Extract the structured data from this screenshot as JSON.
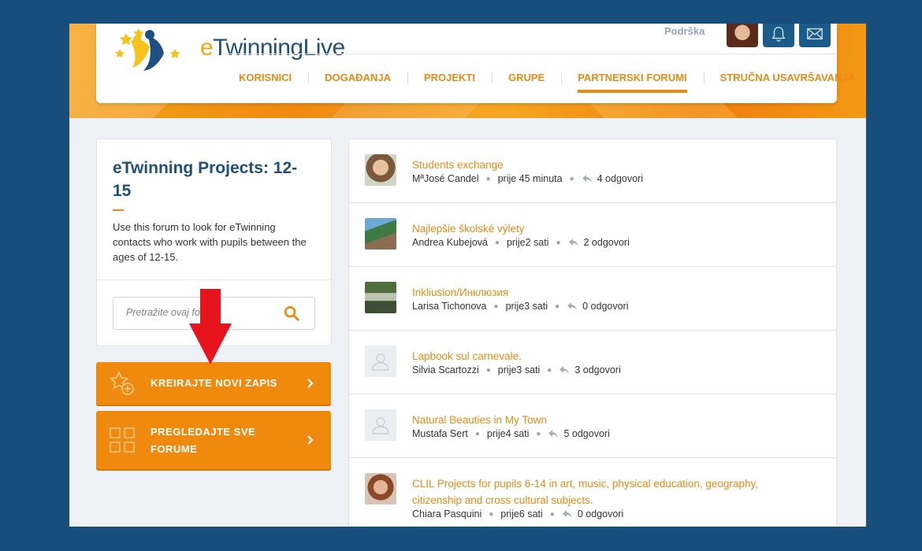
{
  "header": {
    "logo_text_e": "e",
    "logo_text_rest": "Twinning",
    "logo_text_live": "Live",
    "support_label": "Podrška",
    "nav": [
      {
        "label": "KORISNICI",
        "active": false
      },
      {
        "label": "DOGAĐANJA",
        "active": false
      },
      {
        "label": "PROJEKTI",
        "active": false
      },
      {
        "label": "GRUPE",
        "active": false
      },
      {
        "label": "PARTNERSKI FORUMI",
        "active": true
      },
      {
        "label": "STRUČNA USAVRŠAVANJA",
        "active": false
      }
    ]
  },
  "forum_info": {
    "title": "eTwinning Projects: 12-15",
    "description": "Use this forum to look for eTwinning contacts who work with pupils between the ages of 12-15.",
    "search_placeholder": "Pretražite ovaj forum"
  },
  "actions": {
    "create_label": "KREIRAJTE NOVI ZAPIS",
    "browse_label_line1": "PREGLEDAJTE SVE",
    "browse_label_line2": "FORUME"
  },
  "posts": [
    {
      "title": "Students exchange",
      "author": "MªJosé Candel",
      "time": "prije 45 minuta",
      "replies": "4 odgovori",
      "avatar": "photo-woman-smiling"
    },
    {
      "title": "Najlepšie školské výlety",
      "author": "Andrea Kubejová",
      "time": "prije2 sati",
      "replies": "2 odgovori",
      "avatar": "photo-outdoor"
    },
    {
      "title": "Inkliusion/Инклюзия",
      "author": "Larisa Tichonova",
      "time": "prije3 sati",
      "replies": "0 odgovori",
      "avatar": "photo-statue"
    },
    {
      "title": "Lapbook sul carnevale.",
      "author": "Silvia Scartozzi",
      "time": "prije3 sati",
      "replies": "3 odgovori",
      "avatar": "placeholder"
    },
    {
      "title": "Natural Beauties in My Town",
      "author": "Mustafa Sert",
      "time": "prije4 sati",
      "replies": "5 odgovori",
      "avatar": "placeholder"
    },
    {
      "title": "CLIL Projects for pupils 6-14 in art, music, physical education, geography, citizenship and cross cultural subjects.",
      "author": "Chiara Pasquini",
      "time": "prije6 sati",
      "replies": "0 odgovori",
      "avatar": "photo-woman-short-hair"
    }
  ],
  "colors": {
    "accent": "#e68a18",
    "navy": "#1f4f7a",
    "page_bg": "#174e7c",
    "button": "#ef8a0f",
    "annotation_arrow": "#e8141d"
  }
}
